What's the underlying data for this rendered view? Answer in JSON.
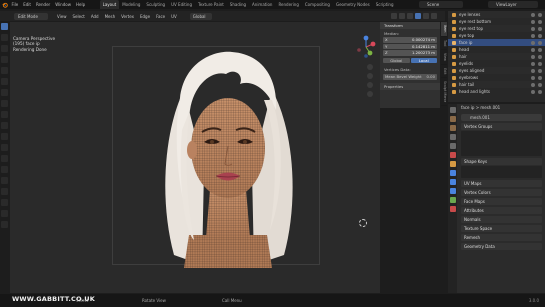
{
  "topbar": {
    "menus": [
      "File",
      "Edit",
      "Render",
      "Window",
      "Help"
    ],
    "workspaces": [
      "Layout",
      "Modeling",
      "Sculpting",
      "UV Editing",
      "Texture Paint",
      "Shading",
      "Animation",
      "Rendering",
      "Compositing",
      "Geometry Nodes",
      "Scripting"
    ],
    "active_workspace": "Layout",
    "scene": "Scene",
    "view_layer": "ViewLayer"
  },
  "viewport_header": {
    "mode": "Edit Mode",
    "menus": [
      "View",
      "Select",
      "Add",
      "Mesh",
      "Vertex",
      "Edge",
      "Face",
      "UV"
    ],
    "orientation": "Global",
    "options": "Options"
  },
  "viewport_overlay": {
    "line1": "Camera Perspective",
    "line2": "(195) face ip",
    "line3": "Rendering Done"
  },
  "n_panel": {
    "header": "Transform",
    "median_label": "Median:",
    "rows": [
      {
        "axis": "X",
        "value": "0.000274 m"
      },
      {
        "axis": "Y",
        "value": "0.142811 m"
      },
      {
        "axis": "Z",
        "value": "1.200273 m"
      }
    ],
    "global_btn": "Global",
    "local_btn": "Local",
    "vertex_data_label": "Vertices Data:",
    "bevel_label": "Mean Bevel Weight",
    "bevel_value": "0.00",
    "properties_label": "Properties",
    "side_tabs": [
      "Item",
      "Tool",
      "View",
      "Edit",
      "Sculpt Mirror"
    ]
  },
  "outliner": {
    "rows": [
      {
        "name": "eye lenses",
        "color": "#d69a43"
      },
      {
        "name": "eye rest bottom",
        "color": "#d69a43"
      },
      {
        "name": "eye rest top",
        "color": "#d69a43"
      },
      {
        "name": "eye top",
        "color": "#d69a43"
      },
      {
        "name": "face ip",
        "color": "#e8b36a"
      },
      {
        "name": "head",
        "color": "#d69a43"
      },
      {
        "name": "hair",
        "color": "#d69a43"
      },
      {
        "name": "eyelids",
        "color": "#d69a43"
      },
      {
        "name": "eyes aligned",
        "color": "#d69a43"
      },
      {
        "name": "eyebrows",
        "color": "#d69a43"
      },
      {
        "name": "hair tail",
        "color": "#d69a43"
      },
      {
        "name": "head and lights",
        "color": "#d69a43"
      }
    ]
  },
  "properties": {
    "breadcrumb": "face ip  >  mesh.001",
    "mesh_name": "mesh.001",
    "sections": [
      "Vertex Groups",
      "Shape Keys",
      "UV Maps",
      "Vertex Colors",
      "Face Maps",
      "Attributes",
      "Normals",
      "Texture Space",
      "Remesh",
      "Geometry Data"
    ]
  },
  "status_bar": {
    "select": "Select",
    "rotate": "Rotate View",
    "menu": "Call Menu",
    "version": "3.0.0"
  },
  "watermark": "WWW.GABBITT.CO.UK",
  "colors": {
    "accent": "#4772b3",
    "selection": "#334d80",
    "object_icon": "#d69a43"
  }
}
